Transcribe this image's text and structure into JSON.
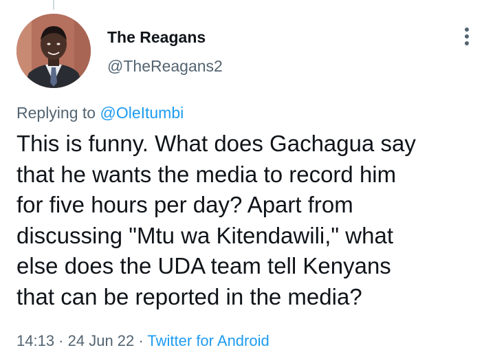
{
  "colors": {
    "text_primary": "#0f1419",
    "text_secondary": "#536471",
    "link": "#1d9bf0",
    "thread_line": "#cfd9de"
  },
  "author": {
    "display_name": "The Reagans",
    "handle": "@TheReagans2",
    "avatar_icon": "profile-photo"
  },
  "reply": {
    "prefix": "Replying to ",
    "mention": "@OleItumbi"
  },
  "tweet": {
    "lines": [
      "This is funny. What does Gachagua say",
      "that he wants the media to record him",
      "for five hours per day? Apart from",
      "discussing \"Mtu wa Kitendawili,\" what",
      "else does the UDA team tell Kenyans",
      "that can be reported in the media?"
    ]
  },
  "meta": {
    "time": "14:13",
    "separator": " · ",
    "date": "24 Jun 22",
    "source": "Twitter for Android"
  },
  "icons": {
    "more": "more-vertical-icon"
  }
}
